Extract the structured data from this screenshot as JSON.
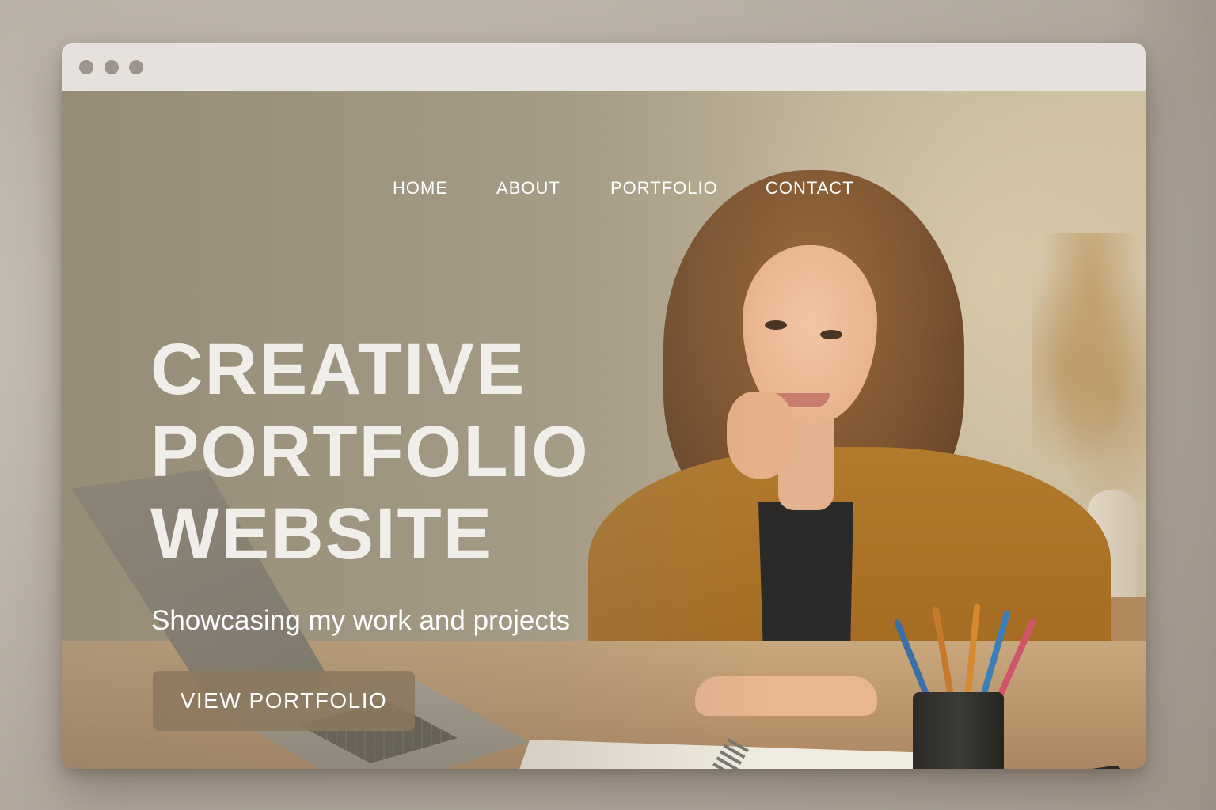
{
  "window": {
    "controls": [
      "dot",
      "dot",
      "dot"
    ]
  },
  "nav": {
    "items": [
      {
        "label": "HOME"
      },
      {
        "label": "ABOUT"
      },
      {
        "label": "PORTFOLIO"
      },
      {
        "label": "CONTACT"
      }
    ]
  },
  "hero": {
    "title_lines": [
      "CREATIVE",
      "PORTFOLIO",
      "WEBSITE"
    ],
    "subtitle": "Showcasing my work and projects",
    "cta_label": "VIEW PORTFOLIO"
  },
  "colors": {
    "accent_button": "#8c785f",
    "jacket": "#a66d23",
    "titlebar": "#e6e1dc"
  }
}
